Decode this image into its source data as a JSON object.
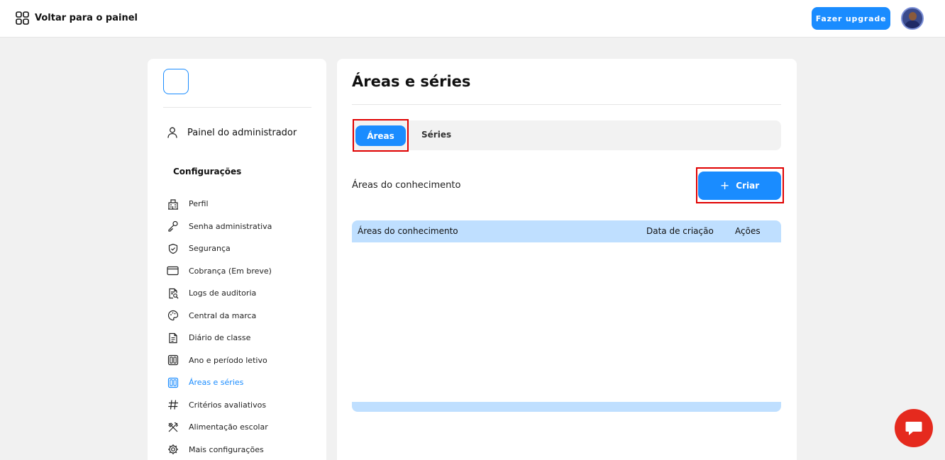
{
  "topbar": {
    "back_label": "Voltar para o painel",
    "back_icon": "grid-icon",
    "upgrade_label": "Fazer upgrade",
    "avatar_icon": "user-avatar"
  },
  "sidebar": {
    "admin_label": "Painel do administrador",
    "section_title": "Configurações",
    "items": [
      {
        "label": "Perfil",
        "icon": "building-icon",
        "active": false
      },
      {
        "label": "Senha administrativa",
        "icon": "key-icon",
        "active": false
      },
      {
        "label": "Segurança",
        "icon": "shield-icon",
        "active": false
      },
      {
        "label": "Cobrança (Em breve)",
        "icon": "card-icon",
        "active": false
      },
      {
        "label": "Logs de auditoria",
        "icon": "document-search-icon",
        "active": false
      },
      {
        "label": "Central da marca",
        "icon": "palette-icon",
        "active": false
      },
      {
        "label": "Diário de classe",
        "icon": "journal-icon",
        "active": false
      },
      {
        "label": "Ano e período letivo",
        "icon": "calendar-grid-icon",
        "active": false
      },
      {
        "label": "Áreas e séries",
        "icon": "areas-grid-icon",
        "active": true
      },
      {
        "label": "Critérios avaliativos",
        "icon": "hash-icon",
        "active": false
      },
      {
        "label": "Alimentação escolar",
        "icon": "utensils-icon",
        "active": false
      },
      {
        "label": "Mais configurações",
        "icon": "gear-icon",
        "active": false
      }
    ]
  },
  "main": {
    "title": "Áreas e séries",
    "tabs": [
      {
        "label": "Áreas",
        "active": true
      },
      {
        "label": "Séries",
        "active": false
      }
    ],
    "subheading": "Áreas do conhecimento",
    "create_label": "Criar",
    "create_icon": "plus-icon",
    "table": {
      "columns": [
        "Áreas do conhecimento",
        "Data de criação",
        "Ações"
      ],
      "rows": []
    }
  },
  "chat": {
    "icon": "chat-icon"
  },
  "colors": {
    "accent": "#1a8cff",
    "table_header": "#bfdfff",
    "highlight": "#e00000",
    "chat": "#e52a1e"
  }
}
